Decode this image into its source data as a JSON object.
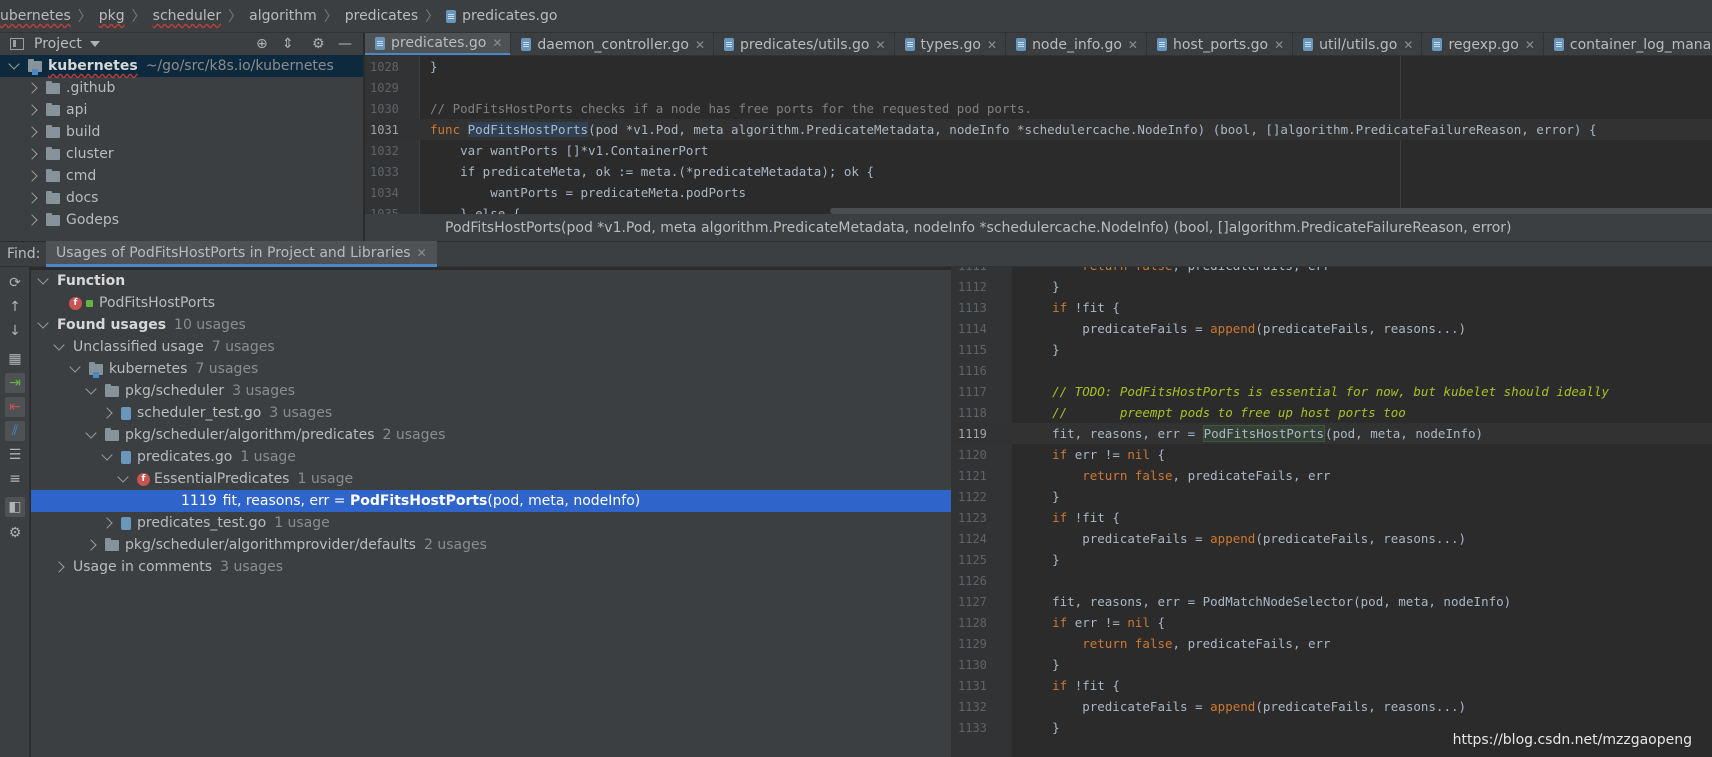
{
  "breadcrumb": {
    "items": [
      "ubernetes",
      "pkg",
      "scheduler",
      "algorithm",
      "predicates",
      "predicates.go"
    ]
  },
  "project": {
    "title": "Project",
    "root_name": "kubernetes",
    "root_path": "~/go/src/k8s.io/kubernetes",
    "folders": [
      ".github",
      "api",
      "build",
      "cluster",
      "cmd",
      "docs",
      "Godeps"
    ]
  },
  "tabs": [
    "predicates.go",
    "daemon_controller.go",
    "predicates/utils.go",
    "types.go",
    "node_info.go",
    "host_ports.go",
    "util/utils.go",
    "regexp.go",
    "container_log_manager_stub.go"
  ],
  "editor": {
    "lines": [
      {
        "n": "1028",
        "t": "}"
      },
      {
        "n": "1029",
        "t": ""
      },
      {
        "n": "1030",
        "t": "// PodFitsHostPorts checks if a node has free ports for the requested pod ports."
      },
      {
        "n": "1031",
        "pre": "func ",
        "fn": "PodFitsHostPorts",
        "post": "(pod *v1.Pod, meta algorithm.PredicateMetadata, nodeInfo *schedulercache.NodeInfo) (bool, []algorithm.PredicateFailureReason, error) {"
      },
      {
        "n": "1032",
        "t": "    var wantPorts []*v1.ContainerPort"
      },
      {
        "n": "1033",
        "t": "    if predicateMeta, ok := meta.(*predicateMetadata); ok {"
      },
      {
        "n": "1034",
        "t": "        wantPorts = predicateMeta.podPorts"
      },
      {
        "n": "1035",
        "t": "    } else {"
      }
    ],
    "signature_hint": "PodFitsHostPorts(pod *v1.Pod, meta algorithm.PredicateMetadata, nodeInfo *schedulercache.NodeInfo) (bool, []algorithm.PredicateFailureReason, error)"
  },
  "find": {
    "label": "Find:",
    "tab_label": "Usages of PodFitsHostPorts in Project and Libraries"
  },
  "usages": {
    "function_header": "Function",
    "function_name": "PodFitsHostPorts",
    "found_label": "Found usages",
    "found_count": "10 usages",
    "unclassified_label": "Unclassified usage",
    "unclassified_count": "7 usages",
    "kubernetes_label": "kubernetes",
    "kubernetes_count": "7 usages",
    "pkg_scheduler": "pkg/scheduler",
    "pkg_scheduler_count": "3 usages",
    "scheduler_test": "scheduler_test.go",
    "scheduler_test_count": "3 usages",
    "predicates_pkg": "pkg/scheduler/algorithm/predicates",
    "predicates_pkg_count": "2 usages",
    "predicates_go": "predicates.go",
    "predicates_go_count": "1 usage",
    "essential": "EssentialPredicates",
    "essential_count": "1 usage",
    "usage_line_no": "1119",
    "usage_pre": "fit, reasons, err = ",
    "usage_fn": "PodFitsHostPorts",
    "usage_post": "(pod, meta, nodeInfo)",
    "predicates_test": "predicates_test.go",
    "predicates_test_count": "1 usage",
    "defaults": "pkg/scheduler/algorithmprovider/defaults",
    "defaults_count": "2 usages",
    "comments": "Usage in comments",
    "comments_count": "3 usages"
  },
  "preview": {
    "lines": [
      {
        "n": "1111",
        "t": "        return false, predicateFails, err"
      },
      {
        "n": "1112",
        "t": "    }"
      },
      {
        "n": "1113",
        "t": "    if !fit {"
      },
      {
        "n": "1114",
        "t": "        predicateFails = append(predicateFails, reasons...)"
      },
      {
        "n": "1115",
        "t": "    }"
      },
      {
        "n": "1116",
        "t": ""
      },
      {
        "n": "1117",
        "t": "    // TODO: PodFitsHostPorts is essential for now, but kubelet should ideally"
      },
      {
        "n": "1118",
        "t": "    //       preempt pods to free up host ports too"
      },
      {
        "n": "1119",
        "t": "    fit, reasons, err = PodFitsHostPorts(pod, meta, nodeInfo)"
      },
      {
        "n": "1120",
        "t": "    if err != nil {"
      },
      {
        "n": "1121",
        "t": "        return false, predicateFails, err"
      },
      {
        "n": "1122",
        "t": "    }"
      },
      {
        "n": "1123",
        "t": "    if !fit {"
      },
      {
        "n": "1124",
        "t": "        predicateFails = append(predicateFails, reasons...)"
      },
      {
        "n": "1125",
        "t": "    }"
      },
      {
        "n": "1126",
        "t": ""
      },
      {
        "n": "1127",
        "t": "    fit, reasons, err = PodMatchNodeSelector(pod, meta, nodeInfo)"
      },
      {
        "n": "1128",
        "t": "    if err != nil {"
      },
      {
        "n": "1129",
        "t": "        return false, predicateFails, err"
      },
      {
        "n": "1130",
        "t": "    }"
      },
      {
        "n": "1131",
        "t": "    if !fit {"
      },
      {
        "n": "1132",
        "t": "        predicateFails = append(predicateFails, reasons...)"
      },
      {
        "n": "1133",
        "t": "    }"
      }
    ]
  },
  "watermark": "https://blog.csdn.net/mzzgaopeng",
  "colors": {
    "accent": "#4a88c7",
    "selection": "#2f65ca",
    "keyword": "#cc7832",
    "comment": "#808080",
    "todo": "#a8c023"
  }
}
